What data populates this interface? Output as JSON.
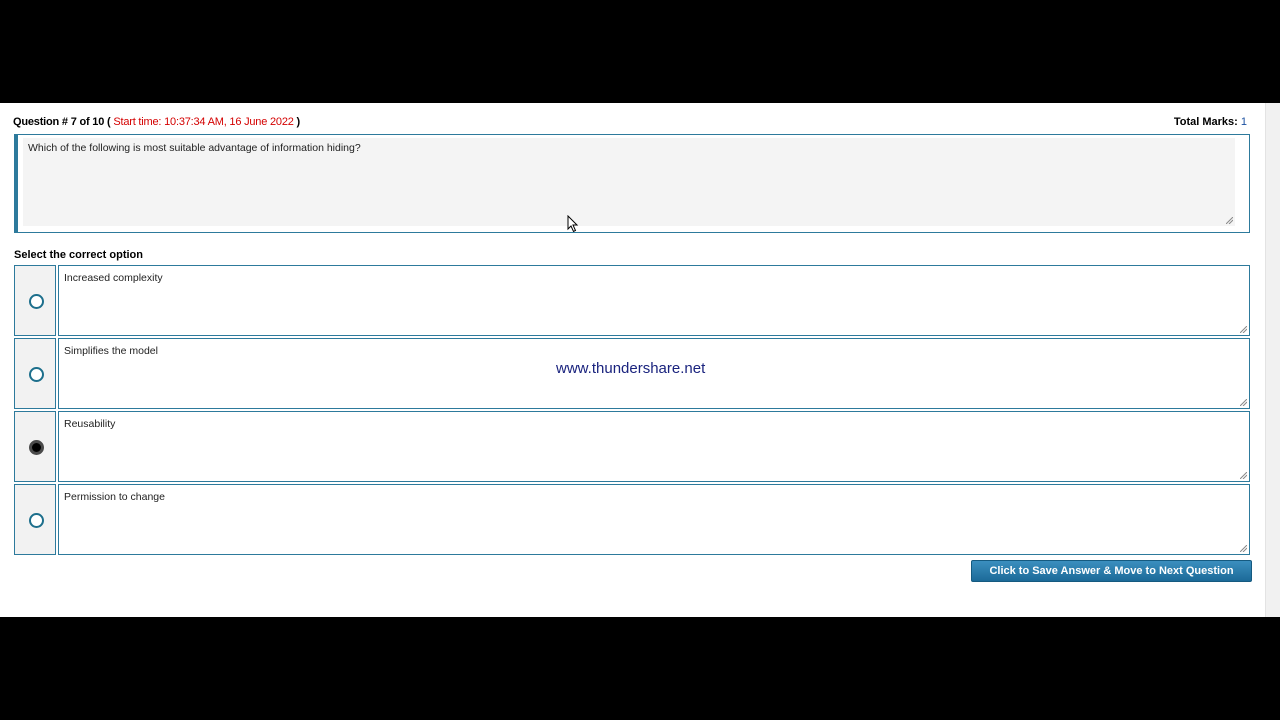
{
  "header": {
    "question_label": "Question # 7 of 10",
    "open_paren": "(",
    "start_time": "Start time: 10:37:34 AM, 16 June 2022",
    "close_paren": ")",
    "total_marks_label": "Total Marks:",
    "total_marks_value": "1"
  },
  "question": {
    "text": "Which of the following is most suitable advantage of information hiding?"
  },
  "instructions": "Select the correct option",
  "options": [
    {
      "text": "Increased complexity",
      "selected": false
    },
    {
      "text": "Simplifies the model",
      "selected": false
    },
    {
      "text": "Reusability",
      "selected": true
    },
    {
      "text": "Permission to change",
      "selected": false
    }
  ],
  "watermark": "www.thundershare.net",
  "next_button_label": "Click to Save Answer & Move to Next Question",
  "colors": {
    "border": "#2d7a9c",
    "start_time": "#d40000",
    "button": "#1c6a98",
    "watermark": "#1a237e"
  }
}
